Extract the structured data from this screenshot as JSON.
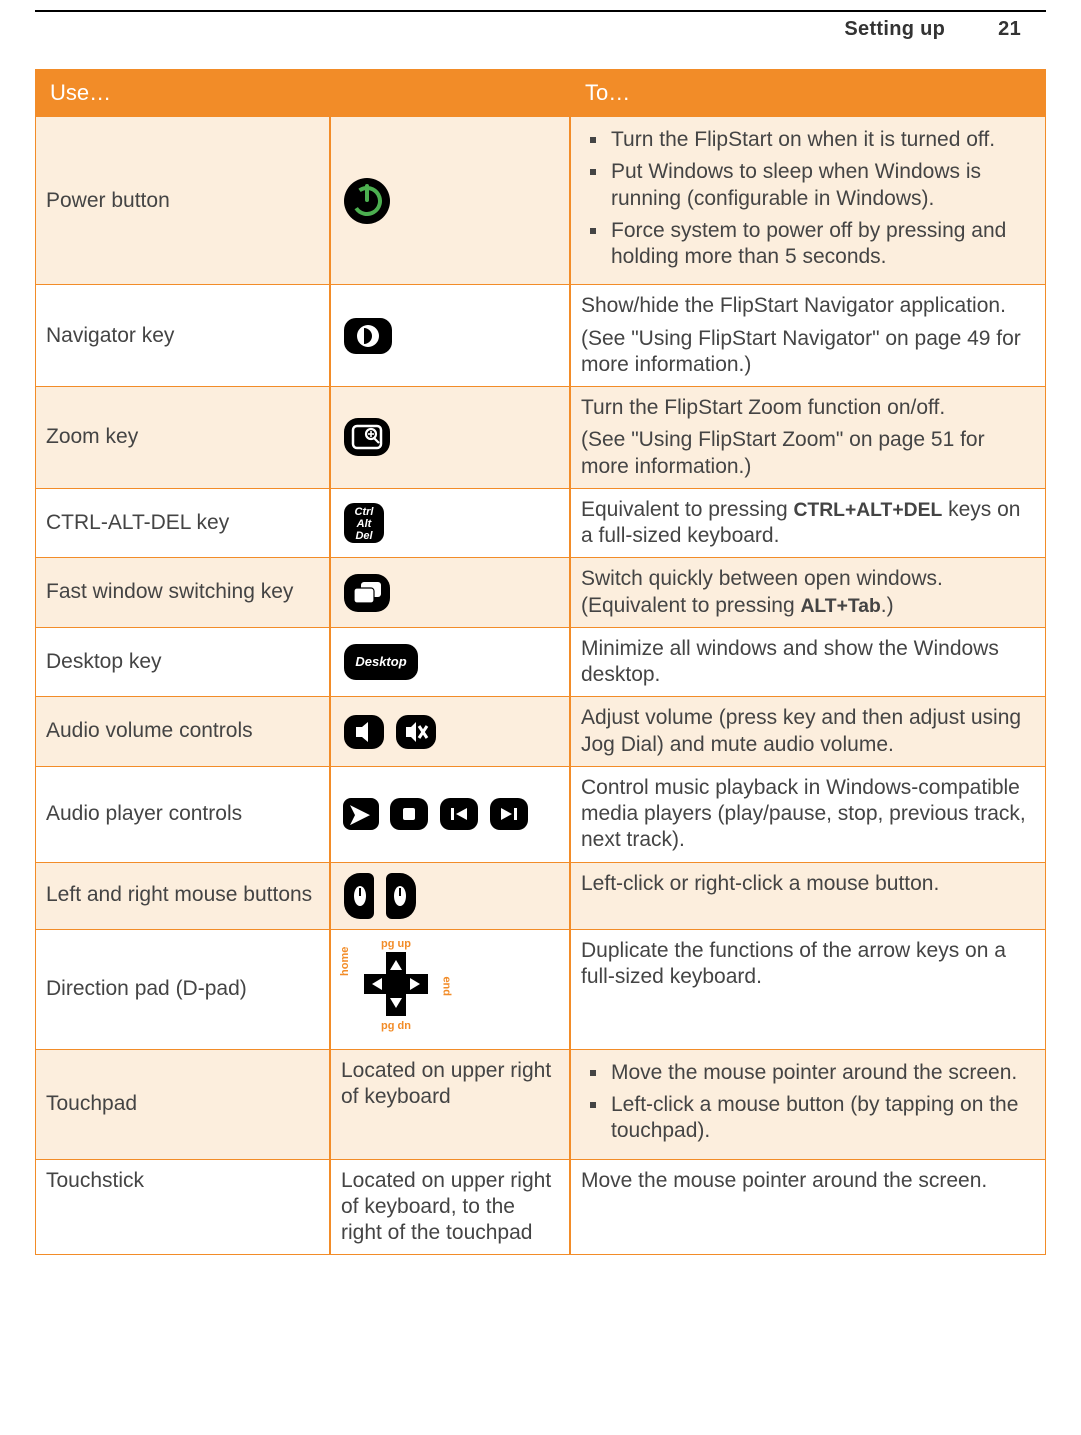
{
  "page_header": {
    "section": "Setting up",
    "page_number": "21"
  },
  "headers": {
    "use": "Use…",
    "to": "To…"
  },
  "rows": {
    "power": {
      "label": "Power button",
      "items": [
        "Turn the FlipStart on when it is turned off.",
        "Put Windows to sleep when Windows is running (configurable in Windows).",
        "Force system to power off by pressing and holding more than 5 seconds."
      ]
    },
    "navigator": {
      "label": "Navigator key",
      "line1": "Show/hide the FlipStart Navigator application.",
      "line2": "(See \"Using FlipStart Navigator\" on page 49 for more information.)"
    },
    "zoom": {
      "label": "Zoom key",
      "line1": "Turn the FlipStart Zoom function on/off.",
      "line2": "(See \"Using FlipStart Zoom\" on page 51 for more information.)"
    },
    "cad": {
      "label": "CTRL-ALT-DEL key",
      "icon_text": "Ctrl\nAlt\nDel",
      "desc_pre": "Equivalent to pressing ",
      "desc_bold": "CTRL+ALT+DEL",
      "desc_post": " keys on a full-sized keyboard."
    },
    "fastswitch": {
      "label": "Fast window switching key",
      "desc_pre": "Switch quickly between open windows. (Equivalent to pressing ",
      "desc_bold": "ALT+Tab",
      "desc_post": ".)"
    },
    "desktop": {
      "label": "Desktop key",
      "icon_text": "Desktop",
      "desc": "Minimize all windows and show the Windows desktop."
    },
    "audiovol": {
      "label": "Audio volume controls",
      "desc": "Adjust volume (press key and then adjust using Jog Dial) and mute audio volume."
    },
    "audioplay": {
      "label": "Audio player controls",
      "desc": "Control music playback in Windows-compatible media players (play/pause, stop, previous track, next track)."
    },
    "mouse": {
      "label": "Left and right mouse buttons",
      "desc": "Left-click or right-click a mouse button."
    },
    "dpad": {
      "label": "Direction pad (D-pad)",
      "labels": {
        "up": "pg up",
        "dn": "pg dn",
        "l": "home",
        "r": "end"
      },
      "desc": "Duplicate the functions of the arrow keys on a full-sized keyboard."
    },
    "touchpad": {
      "label": "Touchpad",
      "location": "Located on upper right of keyboard",
      "items": [
        "Move the mouse pointer around the screen.",
        "Left-click a mouse button (by tapping on the touchpad)."
      ]
    },
    "touchstick": {
      "label": "Touchstick",
      "location": "Located on upper right of keyboard, to the right of the touchpad",
      "desc": "Move the mouse pointer around the screen."
    }
  }
}
